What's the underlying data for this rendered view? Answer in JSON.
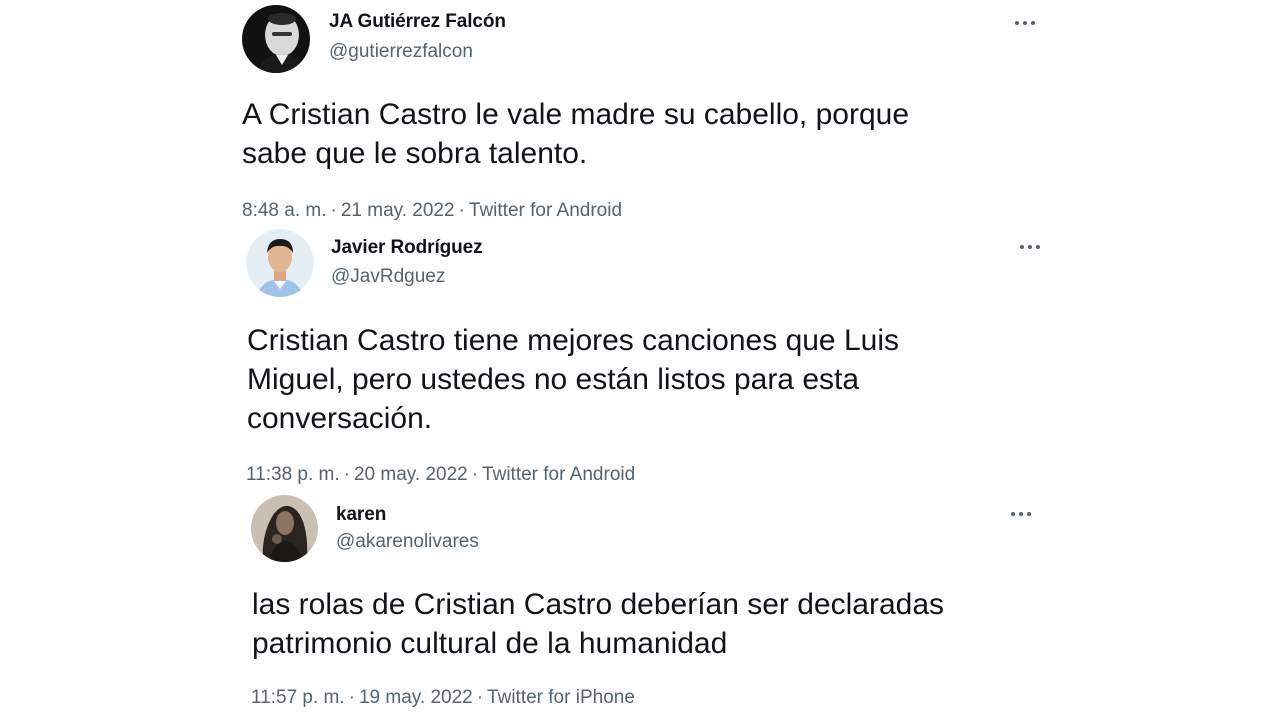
{
  "tweets": [
    {
      "author_name": "JA Gutiérrez Falcón",
      "author_handle": "@gutierrezfalcon",
      "avatar_icon": "profile-photo-man-dark",
      "text_lines": [
        "A Cristian Castro le vale madre su cabello, porque",
        "sabe que le sobra talento."
      ],
      "time": "8:48 a. m.",
      "date": "21 may. 2022",
      "separator": "·",
      "source": "Twitter for Android"
    },
    {
      "author_name": "Javier Rodríguez",
      "author_handle": "@JavRdguez",
      "avatar_icon": "profile-photo-young-man",
      "text_lines": [
        "Cristian Castro tiene mejores canciones que Luis",
        "Miguel, pero ustedes no están listos para esta",
        "conversación."
      ],
      "time": "11:38 p. m.",
      "date": "20 may. 2022",
      "separator": "·",
      "source": "Twitter for Android"
    },
    {
      "author_name": "karen",
      "author_handle": "@akarenolivares",
      "avatar_icon": "profile-photo-woman-dark",
      "text_lines": [
        "las rolas de Cristian Castro deberían ser declaradas",
        "patrimonio cultural de la humanidad"
      ],
      "time": "11:57 p. m.",
      "date": "19 may. 2022",
      "separator": "·",
      "source": "Twitter for iPhone"
    }
  ],
  "icons": {
    "more": "more-options-icon"
  },
  "colors": {
    "text_primary": "#0f1419",
    "text_secondary": "#536471",
    "background": "#ffffff"
  }
}
